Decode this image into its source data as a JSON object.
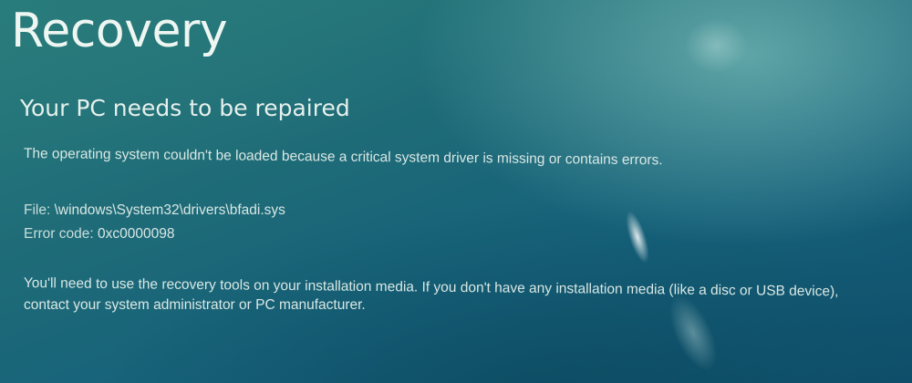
{
  "screen": {
    "title": "Recovery",
    "subtitle": "Your PC needs to be repaired",
    "description": "The operating system couldn't be loaded because a critical system driver is missing or contains errors.",
    "file_label": "File:",
    "file_value": "\\windows\\System32\\drivers\\bfadi.sys",
    "error_label": "Error code:",
    "error_value": "0xc0000098",
    "hint_line1": "You'll need to use the recovery tools on your installation media. If you don't have any installation media (like a disc or USB device),",
    "hint_line2": "contact your system administrator or PC manufacturer."
  },
  "colors": {
    "background": "#1f6c78",
    "text": "#e9f2ee"
  }
}
